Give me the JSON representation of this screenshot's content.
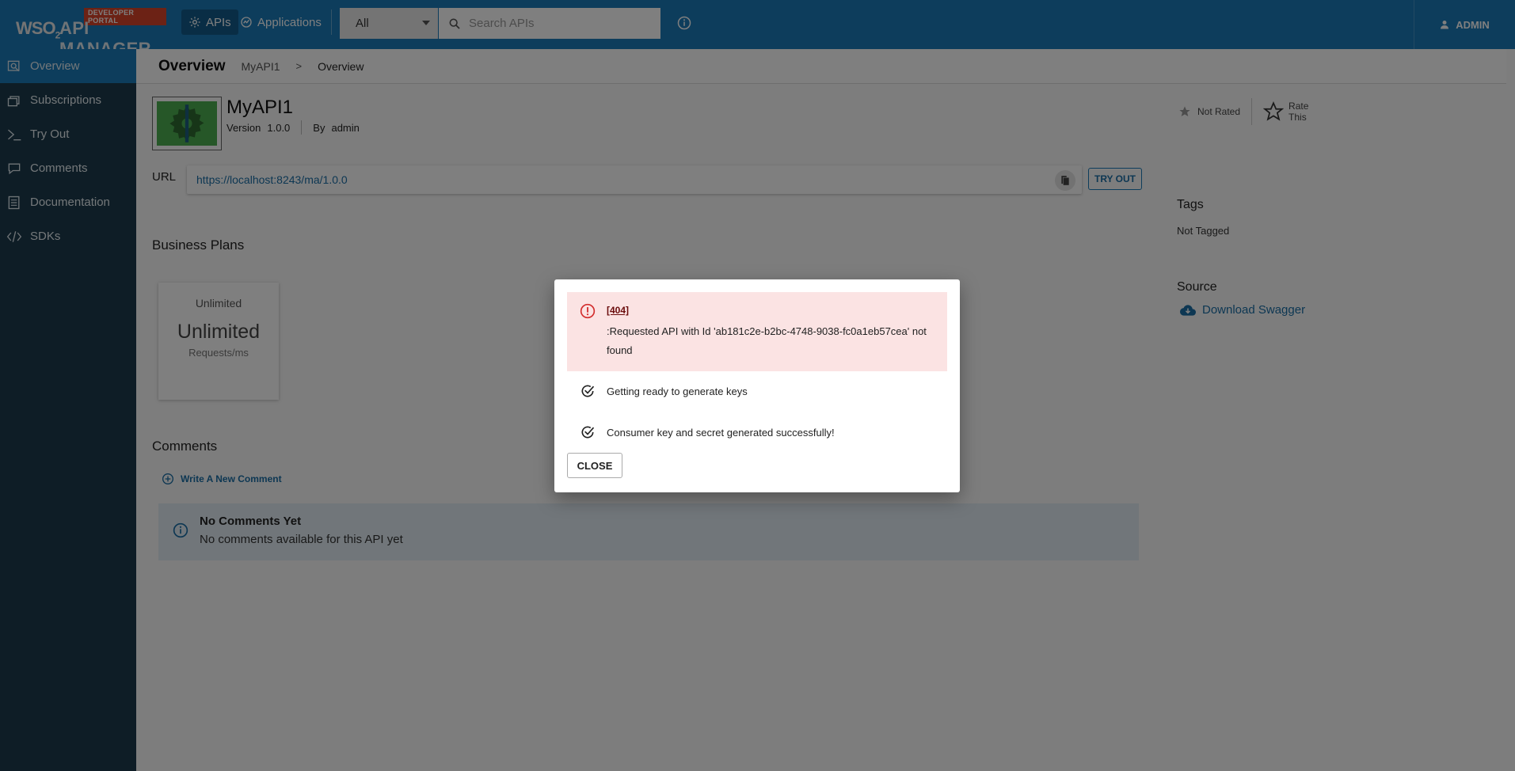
{
  "header": {
    "badge": "DEVELOPER PORTAL",
    "logo_prefix": "WSO",
    "logo_suffix": "2",
    "product_name": "API MANAGER",
    "nav": {
      "apis": "APIs",
      "applications": "Applications"
    },
    "search_scope": "All",
    "search_placeholder": "Search APIs",
    "user": "ADMIN",
    "color": "#1a7ab8"
  },
  "sidebar": {
    "items": [
      {
        "label": "Overview",
        "icon": "overview-icon"
      },
      {
        "label": "Subscriptions",
        "icon": "subscriptions-icon"
      },
      {
        "label": "Try Out",
        "icon": "terminal-icon"
      },
      {
        "label": "Comments",
        "icon": "comments-icon"
      },
      {
        "label": "Documentation",
        "icon": "documentation-icon"
      },
      {
        "label": "SDKs",
        "icon": "code-icon"
      }
    ],
    "active_index": 0,
    "color": "#1d3b4c"
  },
  "breadcrumb": {
    "title": "Overview",
    "api": "MyAPI1",
    "separator": ">",
    "current": "Overview"
  },
  "api": {
    "name": "MyAPI1",
    "version_label": "Version",
    "version": "1.0.0",
    "by_label": "By",
    "author": "admin",
    "rating": "Not Rated",
    "rate_line1": "Rate",
    "rate_line2": "This",
    "url_label": "URL",
    "url": "https://localhost:8243/ma/1.0.0",
    "try_out": "TRY OUT"
  },
  "business_plans": {
    "title": "Business Plans",
    "plans": [
      {
        "name": "Unlimited",
        "quota": "Unlimited",
        "unit": "Requests/ms"
      }
    ]
  },
  "comments": {
    "title": "Comments",
    "write_label": "Write A New Comment",
    "empty_title": "No Comments Yet",
    "empty_text": "No comments available for this API yet"
  },
  "side_panel": {
    "tags_title": "Tags",
    "tags_text": "Not Tagged",
    "source_title": "Source",
    "download_label": "Download Swagger"
  },
  "modal": {
    "error_code": "[404]",
    "error_message": ":Requested API with Id 'ab181c2e-b2bc-4748-9038-fc0a1eb57cea' not found",
    "steps": [
      "Getting ready to generate keys",
      "Consumer key and secret generated successfully!"
    ],
    "close_label": "CLOSE"
  }
}
